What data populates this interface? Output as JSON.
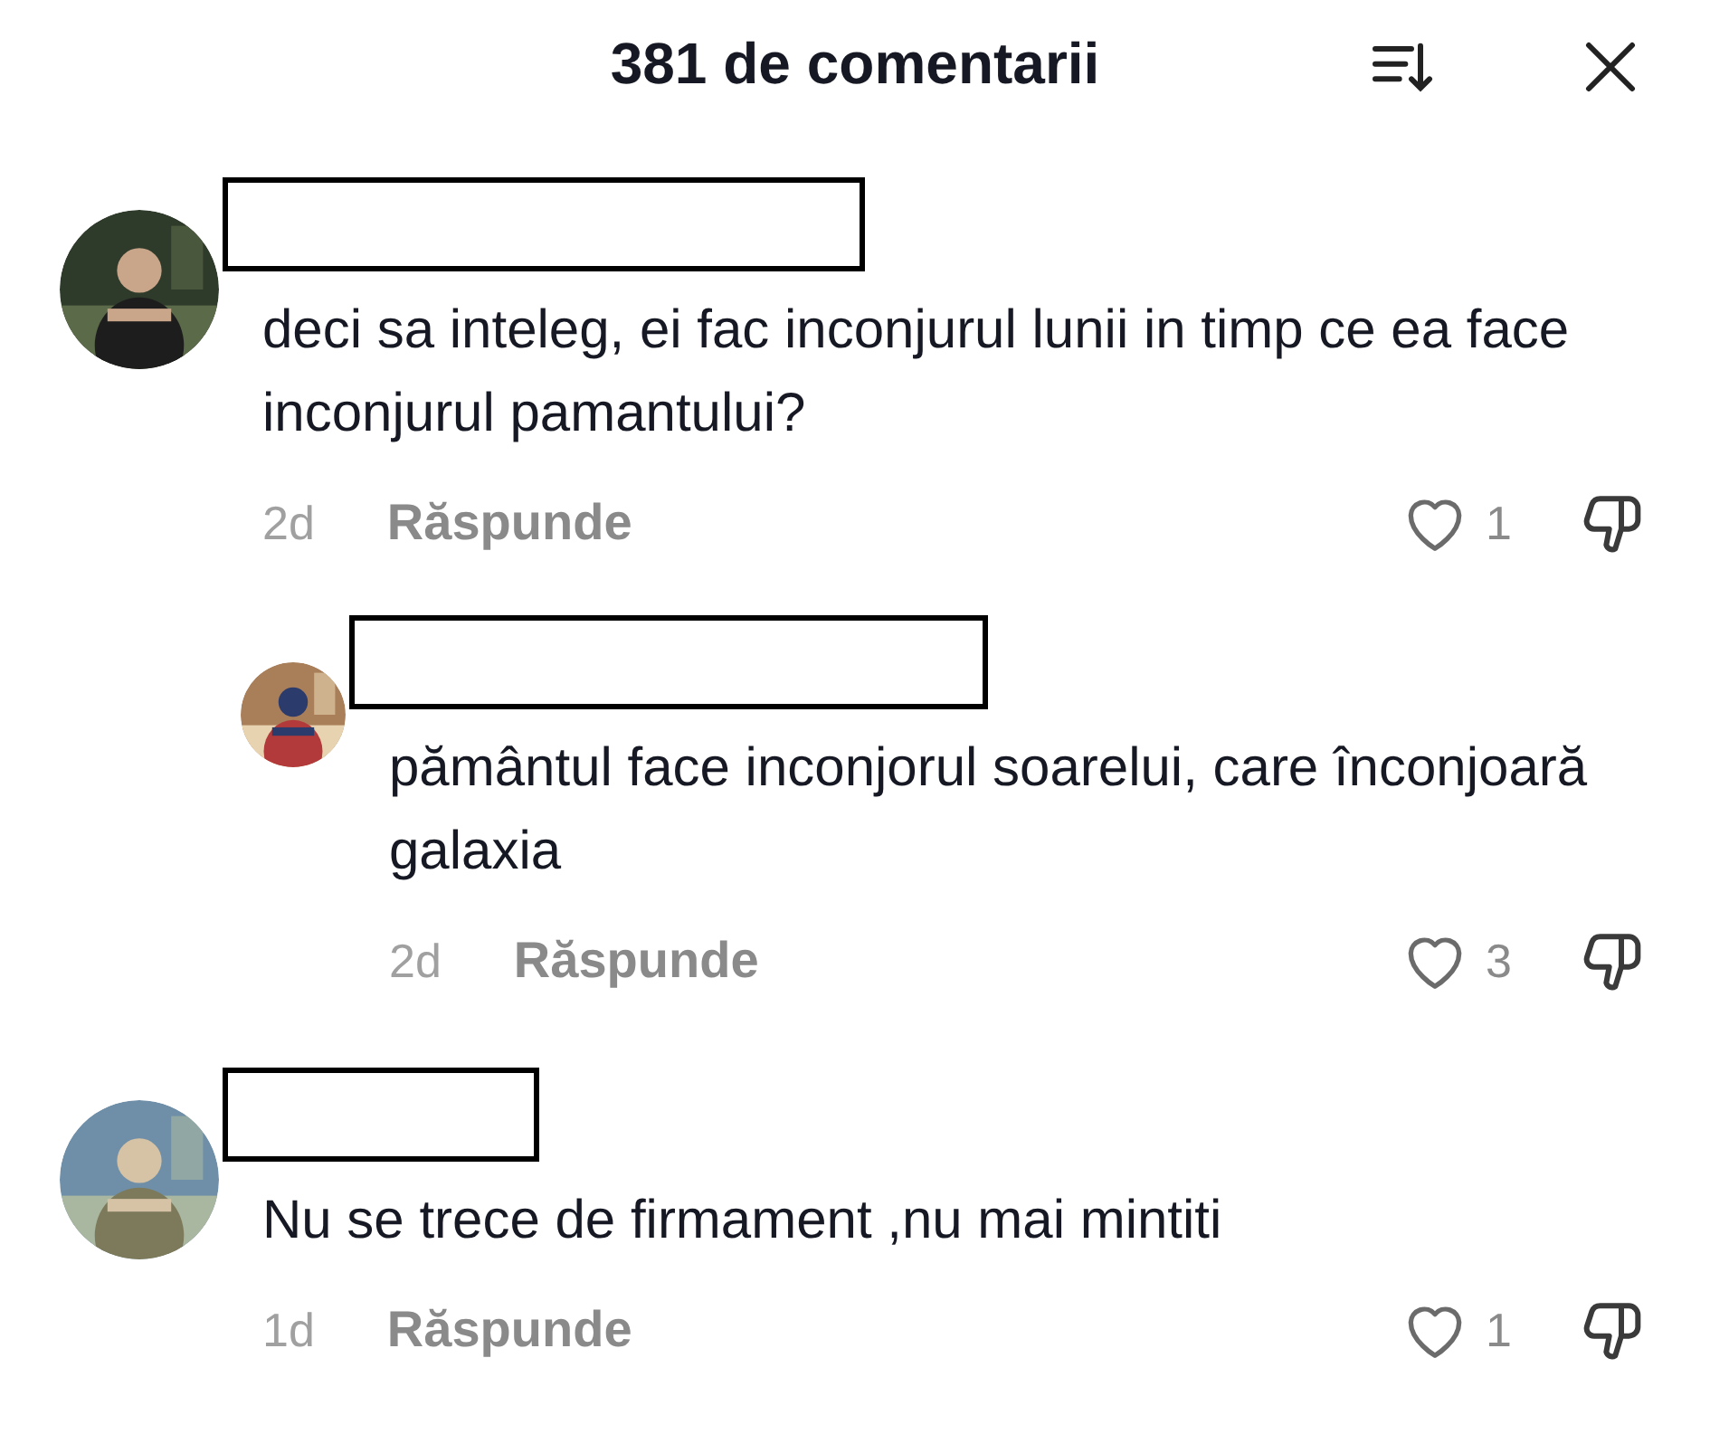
{
  "header": {
    "title": "381 de comentarii"
  },
  "comments": [
    {
      "text": "deci sa inteleg, ei fac inconjurul lunii in timp ce ea face inconjurul pamantului?",
      "time": "2d",
      "reply_label": "Răspunde",
      "likes": "1",
      "liked": false,
      "replies": [
        {
          "text": "pământul face inconjorul soarelui, care înconjoară galaxia",
          "time": "2d",
          "reply_label": "Răspunde",
          "likes": "3",
          "liked": false
        }
      ]
    },
    {
      "text": "Nu se trece de firmament ,nu mai mintiti",
      "time": "1d",
      "reply_label": "Răspunde",
      "likes": "1",
      "liked": false
    }
  ]
}
